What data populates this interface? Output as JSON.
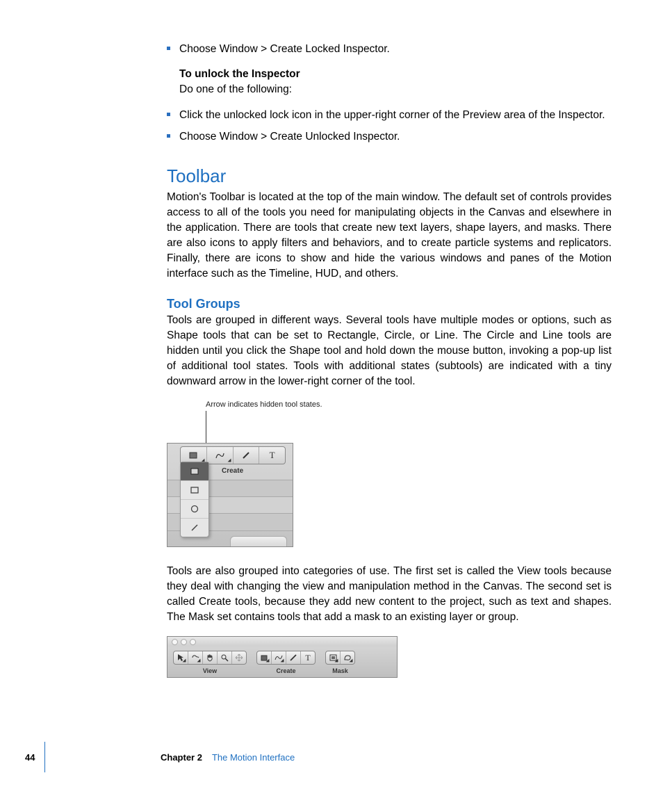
{
  "bullets_top": [
    "Choose Window > Create Locked Inspector."
  ],
  "unlock": {
    "heading": "To unlock the Inspector",
    "instruction": "Do one of the following:"
  },
  "bullets_unlock": [
    "Click the unlocked lock icon in the upper-right corner of the Preview area of the Inspector.",
    "Choose Window > Create Unlocked Inspector."
  ],
  "toolbar": {
    "heading": "Toolbar",
    "body": "Motion's Toolbar is located at the top of the main window. The default set of controls provides access to all of the tools you need for manipulating objects in the Canvas and elsewhere in the application. There are tools that create new text layers, shape layers, and masks. There are also icons to apply filters and behaviors, and to create particle systems and replicators. Finally, there are icons to show and hide the various windows and panes of the Motion interface such as the Timeline, HUD, and others."
  },
  "toolgroups": {
    "heading": "Tool Groups",
    "body1": "Tools are grouped in different ways. Several tools have multiple modes or options, such as Shape tools that can be set to Rectangle, Circle, or Line. The Circle and Line tools are hidden until you click the Shape tool and hold down the mouse button, invoking a pop-up list of additional tool states. Tools with additional states (subtools) are indicated with a tiny downward arrow in the lower-right corner of the tool.",
    "callout": "Arrow indicates hidden tool states.",
    "create_label": "Create",
    "body2": "Tools are also grouped into categories of use. The first set is called the View tools because they deal with changing the view and manipulation method in the Canvas. The second set is called Create tools, because they add new content to the project, such as text and shapes. The Mask set contains tools that add a mask to an existing layer or group."
  },
  "toolbar_groups": {
    "view": "View",
    "create": "Create",
    "mask": "Mask"
  },
  "footer": {
    "page": "44",
    "chapter_label": "Chapter 2",
    "chapter_title": "The Motion Interface"
  }
}
